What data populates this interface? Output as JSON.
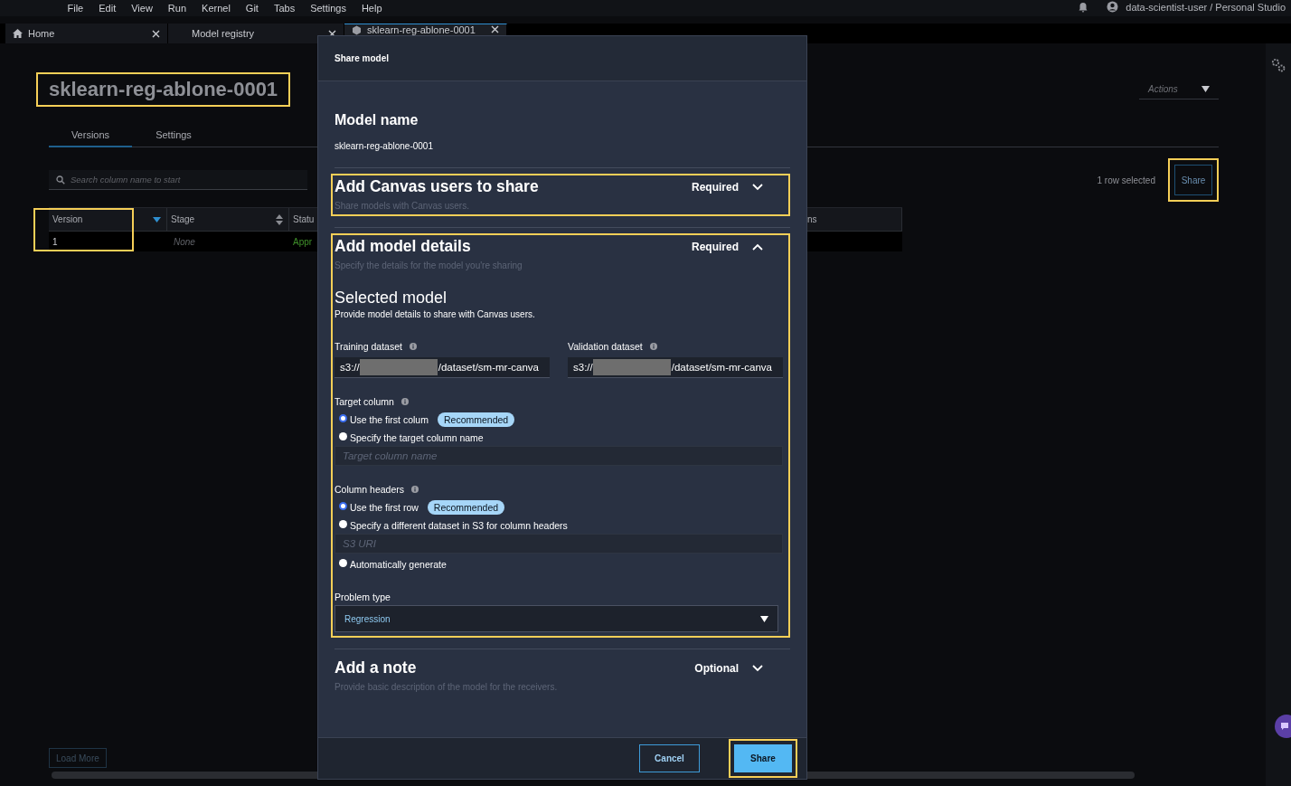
{
  "menu_bar": {
    "items": [
      "File",
      "Edit",
      "View",
      "Run",
      "Kernel",
      "Git",
      "Tabs",
      "Settings",
      "Help"
    ],
    "user": "data-scientist-user / Personal Studio"
  },
  "tabs": [
    {
      "label": "Home",
      "selected": false,
      "kind": "home"
    },
    {
      "label": "Model registry",
      "selected": false,
      "kind": "plain"
    },
    {
      "label": "sklearn-reg-ablone-0001",
      "selected": true,
      "kind": "model"
    }
  ],
  "page": {
    "title": "sklearn-reg-ablone-0001",
    "title_highlighted": true,
    "actions": "Actions",
    "subtabs": [
      {
        "label": "Versions",
        "selected": true
      },
      {
        "label": "Settings",
        "selected": false
      }
    ],
    "search": {
      "placeholder": "Search column name to start"
    },
    "selection_count": "1 row selected",
    "share_button": {
      "label": "Share",
      "highlighted": true
    },
    "table": {
      "version_highlighted": true,
      "columns": [
        {
          "label": "Version",
          "kind": "sorted"
        },
        {
          "label": "Stage",
          "kind": "sortable"
        },
        {
          "label": "Statu",
          "kind": "plain"
        },
        {
          "label": "ns",
          "kind": "plain"
        }
      ],
      "rows": [
        {
          "version": "1",
          "stage": "None",
          "status": "Appr"
        }
      ]
    },
    "load_more": "Load More"
  },
  "modal": {
    "title": "Share model",
    "model_name_heading": "Model name",
    "model_name": "sklearn-reg-ablone-0001",
    "sections": [
      {
        "title": "Add Canvas users to share",
        "description": "Share models with Canvas users.",
        "requirement": "Required",
        "expanded": false,
        "highlighted": true
      },
      {
        "title": "Add model details",
        "description": "Specify the details for the model you're sharing",
        "requirement": "Required",
        "expanded": true,
        "highlighted": true,
        "details": {
          "heading": "Selected model",
          "subheading": "Provide model details to share with Canvas users.",
          "datasets": [
            {
              "label": "Training dataset",
              "prefix": "s3://",
              "suffix": "/dataset/sm-mr-canva"
            },
            {
              "label": "Validation dataset",
              "prefix": "s3://",
              "suffix": "/dataset/sm-mr-canva"
            }
          ],
          "groups": [
            {
              "label": "Target column",
              "options": [
                {
                  "kind": "radio",
                  "label": "Use the first colum",
                  "selected": true,
                  "badge": "Recommended"
                },
                {
                  "kind": "radio",
                  "label": "Specify the target column name",
                  "selected": false
                },
                {
                  "kind": "field",
                  "placeholder": "Target column name"
                }
              ]
            },
            {
              "label": "Column headers",
              "options": [
                {
                  "kind": "radio",
                  "label": "Use the first row",
                  "selected": true,
                  "badge": "Recommended"
                },
                {
                  "kind": "radio",
                  "label": "Specify a different dataset in S3 for column headers",
                  "selected": false
                },
                {
                  "kind": "field",
                  "placeholder": "S3 URI"
                },
                {
                  "kind": "radio",
                  "label": "Automatically generate",
                  "selected": false
                }
              ]
            }
          ],
          "problem_type": {
            "label": "Problem type",
            "value": "Regression"
          }
        }
      },
      {
        "title": "Add a note",
        "description": "Provide basic description of the model for the receivers.",
        "requirement": "Optional",
        "expanded": false,
        "highlighted": false
      }
    ],
    "buttons": [
      {
        "label": "Cancel",
        "kind": "secondary",
        "highlighted": false
      },
      {
        "label": "Share",
        "kind": "primary",
        "highlighted": true
      }
    ]
  }
}
